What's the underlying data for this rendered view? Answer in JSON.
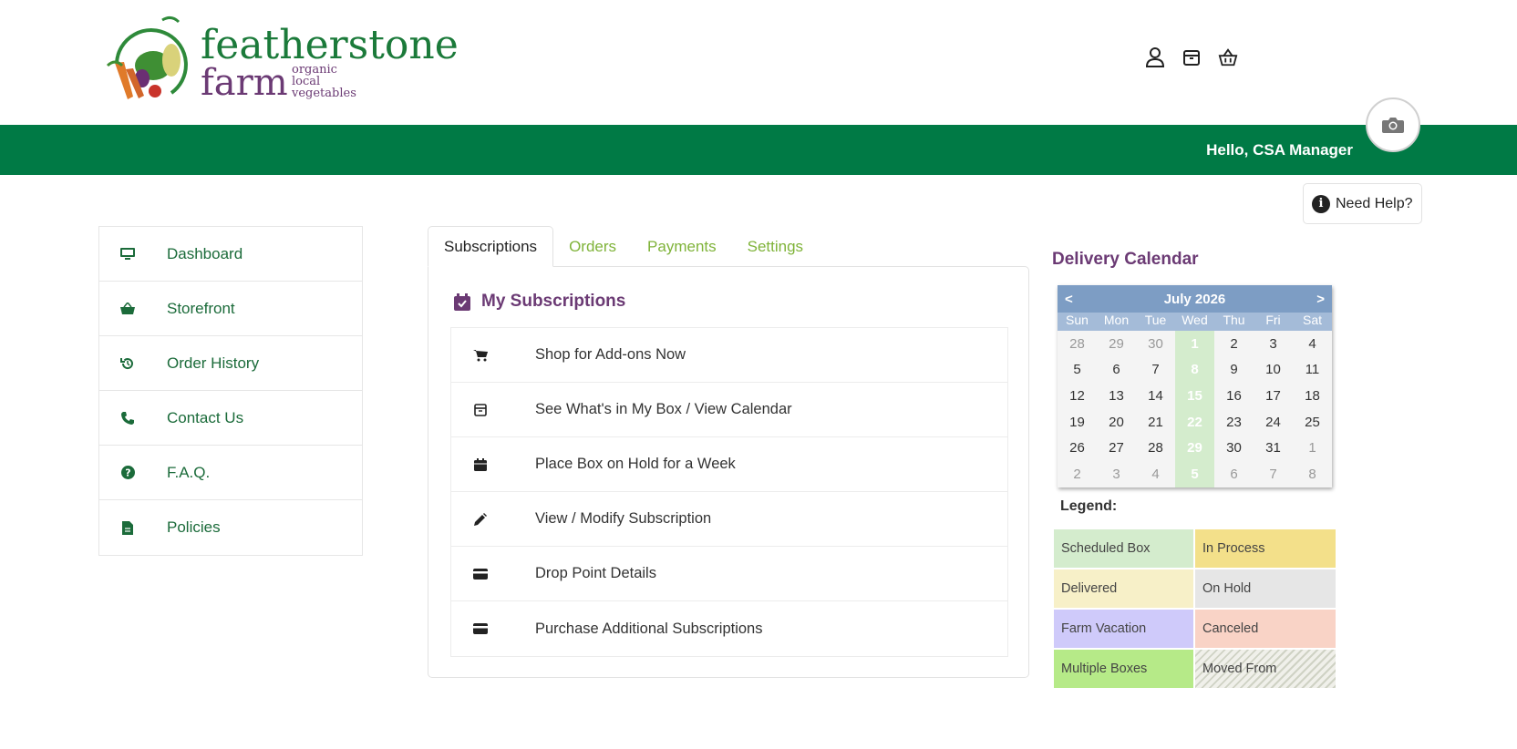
{
  "brand": {
    "name_line1": "featherstone",
    "name_line2": "farm",
    "tagline": [
      "organic",
      "local",
      "vegetables"
    ]
  },
  "header": {
    "icons": [
      "user-icon",
      "box-icon",
      "basket-icon"
    ],
    "greeting": "Hello, CSA Manager",
    "help_label": "Need Help?"
  },
  "sidebar": {
    "items": [
      {
        "label": "Dashboard",
        "icon": "monitor-icon"
      },
      {
        "label": "Storefront",
        "icon": "basket-icon"
      },
      {
        "label": "Order History",
        "icon": "history-icon"
      },
      {
        "label": "Contact Us",
        "icon": "phone-icon"
      },
      {
        "label": "F.A.Q.",
        "icon": "question-icon"
      },
      {
        "label": "Policies",
        "icon": "document-icon"
      }
    ]
  },
  "tabs": [
    {
      "label": "Subscriptions",
      "active": true
    },
    {
      "label": "Orders",
      "active": false
    },
    {
      "label": "Payments",
      "active": false
    },
    {
      "label": "Settings",
      "active": false
    }
  ],
  "subscriptions": {
    "title": "My Subscriptions",
    "items": [
      {
        "label": "Shop for Add-ons Now",
        "icon": "cart-icon"
      },
      {
        "label": "See What's in My Box / View Calendar",
        "icon": "box-icon"
      },
      {
        "label": "Place Box on Hold for a Week",
        "icon": "calendar-icon"
      },
      {
        "label": "View / Modify Subscription",
        "icon": "pencil-icon"
      },
      {
        "label": "Drop Point Details",
        "icon": "card-icon"
      },
      {
        "label": "Purchase Additional Subscriptions",
        "icon": "card-icon"
      }
    ]
  },
  "calendar": {
    "title": "Delivery Calendar",
    "month": "July 2026",
    "prev": "<",
    "next": ">",
    "weekdays": [
      "Sun",
      "Mon",
      "Tue",
      "Wed",
      "Thu",
      "Fri",
      "Sat"
    ],
    "weeks": [
      [
        "28",
        "29",
        "30",
        "1",
        "2",
        "3",
        "4"
      ],
      [
        "5",
        "6",
        "7",
        "8",
        "9",
        "10",
        "11"
      ],
      [
        "12",
        "13",
        "14",
        "15",
        "16",
        "17",
        "18"
      ],
      [
        "19",
        "20",
        "21",
        "22",
        "23",
        "24",
        "25"
      ],
      [
        "26",
        "27",
        "28",
        "29",
        "30",
        "31",
        "1"
      ],
      [
        "2",
        "3",
        "4",
        "5",
        "6",
        "7",
        "8"
      ]
    ],
    "scheduled_dates": [
      "1",
      "8",
      "15",
      "22",
      "29",
      "5"
    ]
  },
  "legend": {
    "title": "Legend:",
    "items": [
      {
        "label": "Scheduled Box",
        "color": "#d4eccd"
      },
      {
        "label": "In Process",
        "color": "#f3e08a"
      },
      {
        "label": "Delivered",
        "color": "#f7f0c8"
      },
      {
        "label": "On Hold",
        "color": "#e6e6e6"
      },
      {
        "label": "Farm Vacation",
        "color": "#cfcafa"
      },
      {
        "label": "Canceled",
        "color": "#f9d3c6"
      },
      {
        "label": "Multiple Boxes",
        "color": "#b6ea88"
      },
      {
        "label": "Moved From",
        "color": "#e8e8e0"
      }
    ]
  },
  "colors": {
    "brand_green": "#007a45",
    "brand_purple": "#6b3a74",
    "tab_green": "#7fb339",
    "calendar_header": "#7d9dc4"
  }
}
